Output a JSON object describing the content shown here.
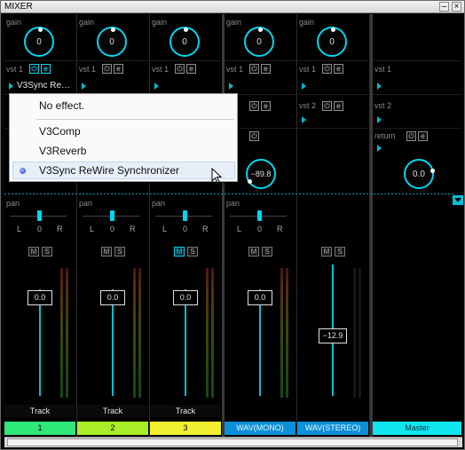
{
  "window": {
    "title": "MIXER",
    "btn_minimize": "–",
    "btn_close": "×"
  },
  "labels": {
    "gain": "gain",
    "vst1": "vst 1",
    "vst2": "vst 2",
    "pan": "pan",
    "send": "send",
    "return": "return",
    "L": "L",
    "R": "R",
    "mute": "M",
    "solo": "S"
  },
  "channels": [
    {
      "name": "Track",
      "chip": "1",
      "chip_color": "#2ee87a",
      "gain": "0",
      "pan": "0",
      "fader": "0.0",
      "fx": "V3Sync Re…",
      "mute_on": false
    },
    {
      "name": "Track",
      "chip": "2",
      "chip_color": "#a9ec28",
      "gain": "0",
      "pan": "0",
      "fader": "0.0",
      "fx": "",
      "mute_on": false
    },
    {
      "name": "Track",
      "chip": "3",
      "chip_color": "#f0f030",
      "gain": "0",
      "pan": "0",
      "fader": "0.0",
      "fx": "",
      "mute_on": true
    },
    {
      "name": "WAV(MONO)",
      "chip": "",
      "chip_color": "#0b8fd8",
      "gain": "0",
      "pan": "0",
      "fader": "0.0",
      "send_knob": "−89.8",
      "fx": "",
      "mute_on": false
    },
    {
      "name": "WAV(STEREO)",
      "chip": "",
      "chip_color": "#0b8fd8",
      "gain": "0",
      "pan": "",
      "fader": "−12.9",
      "fx": "",
      "mute_on": false
    },
    {
      "name": "Master",
      "chip": "",
      "chip_color": "#11e6f0",
      "gain": "",
      "return_knob": "0.0",
      "fx": "",
      "mute_on": false
    }
  ],
  "menu": {
    "items": [
      "No effect.",
      "V3Comp",
      "V3Reverb",
      "V3Sync ReWire Synchronizer"
    ],
    "selected": "V3Sync ReWire Synchronizer"
  },
  "colors": {
    "accent": "#00d6ee",
    "background": "#000000"
  }
}
